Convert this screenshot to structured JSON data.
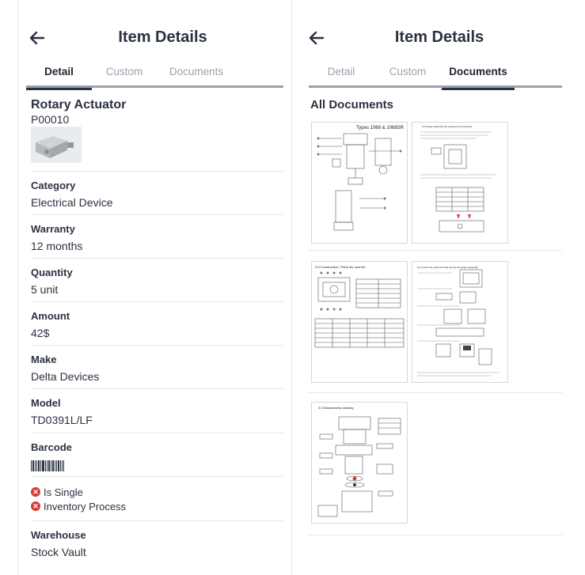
{
  "left": {
    "title": "Item Details",
    "tabs": [
      {
        "label": "Detail",
        "active": true
      },
      {
        "label": "Custom",
        "active": false
      },
      {
        "label": "Documents",
        "active": false
      }
    ],
    "item": {
      "name": "Rotary Actuator",
      "code": "P00010"
    },
    "fields": [
      {
        "label": "Category",
        "value": "Electrical Device"
      },
      {
        "label": "Warranty",
        "value": "12 months"
      },
      {
        "label": "Quantity",
        "value": "5 unit"
      },
      {
        "label": "Amount",
        "value": "42$"
      },
      {
        "label": "Make",
        "value": "Delta Devices"
      },
      {
        "label": "Model",
        "value": "TD0391L/LF"
      },
      {
        "label": "Barcode",
        "value": ""
      }
    ],
    "flags": [
      {
        "label": "Is Single",
        "icon": "x-circle-icon",
        "color": "#d93a32"
      },
      {
        "label": "Inventory Process",
        "icon": "x-circle-icon",
        "color": "#d93a32"
      }
    ],
    "warehouse": {
      "label": "Warehouse",
      "value": "Stock Vault"
    }
  },
  "right": {
    "title": "Item Details",
    "tabs": [
      {
        "label": "Detail",
        "active": false
      },
      {
        "label": "Custom",
        "active": false
      },
      {
        "label": "Documents",
        "active": true
      }
    ],
    "docs_heading": "All Documents",
    "documents": [
      {
        "caption": "Types 1068 & 1068SR"
      },
      {
        "caption": "3.5 Finger assembly set replacement procedure"
      },
      {
        "caption": "3.6 Construction / Parts list, seal list"
      },
      {
        "caption": "(1) Loosen the guide bolt and remove the finger assembly."
      },
      {
        "caption": "3.5 Disassembly drawing"
      }
    ]
  },
  "colors": {
    "text": "#2a3140",
    "muted": "#9aa3ad",
    "error": "#d93a32",
    "divider": "#e3e5e8"
  }
}
